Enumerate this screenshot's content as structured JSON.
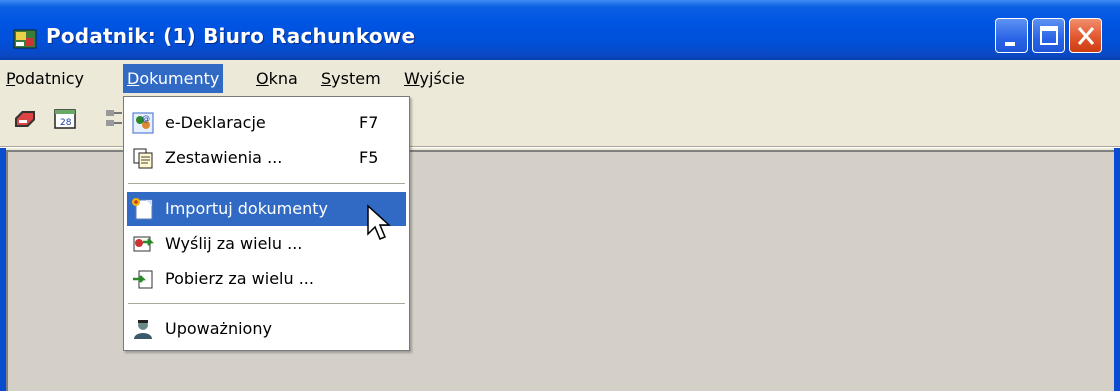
{
  "window": {
    "title": "Podatnik: (1) Biuro Rachunkowe",
    "title_color": "#0054e3",
    "close_color": "#e2582e"
  },
  "menubar": {
    "items": [
      {
        "label_underlined": "P",
        "label_rest": "odatnicy"
      },
      {
        "label_underlined": "D",
        "label_rest": "okumenty",
        "active": true
      },
      {
        "label_underlined": "O",
        "label_rest": "kna"
      },
      {
        "label_underlined": "S",
        "label_rest": "ystem"
      },
      {
        "label_underlined": "W",
        "label_rest": "yjście"
      }
    ]
  },
  "toolbar": {
    "icons": [
      "printer-icon",
      "calendar-icon",
      "network-icon"
    ]
  },
  "dropdown": {
    "items": [
      {
        "label": "e-Deklaracje",
        "shortcut": "F7",
        "icon": "e-declaration-icon"
      },
      {
        "label": "Zestawienia ...",
        "shortcut": "F5",
        "icon": "reports-icon"
      },
      {
        "label": "Importuj dokumenty",
        "shortcut": "",
        "icon": "import-document-icon",
        "highlighted": true
      },
      {
        "label": "Wyślij za wielu ...",
        "shortcut": "",
        "icon": "send-icon"
      },
      {
        "label": "Pobierz za wielu ...",
        "shortcut": "",
        "icon": "download-icon"
      },
      {
        "label": "Upoważniony",
        "shortcut": "",
        "icon": "authorized-person-icon"
      }
    ],
    "highlight_color": "#316ac5"
  }
}
